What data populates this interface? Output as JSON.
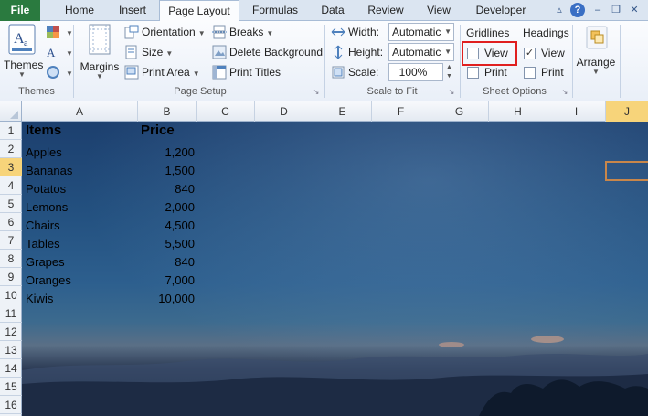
{
  "tabs": [
    "File",
    "Home",
    "Insert",
    "Page Layout",
    "Formulas",
    "Data",
    "Review",
    "View",
    "Developer"
  ],
  "active_tab": "Page Layout",
  "window_controls": {
    "help": "?",
    "minimize": "–",
    "restore": "❐",
    "close": "✕"
  },
  "ribbon": {
    "themes": {
      "themes_label": "Themes",
      "group_label": "Themes"
    },
    "page_setup": {
      "margins_label": "Margins",
      "orientation_label": "Orientation",
      "size_label": "Size",
      "print_area_label": "Print Area",
      "breaks_label": "Breaks",
      "delete_background_label": "Delete Background",
      "print_titles_label": "Print Titles",
      "group_label": "Page Setup"
    },
    "scale_to_fit": {
      "width_label": "Width:",
      "width_value": "Automatic",
      "height_label": "Height:",
      "height_value": "Automatic",
      "scale_label": "Scale:",
      "scale_value": "100%",
      "group_label": "Scale to Fit"
    },
    "sheet_options": {
      "gridlines_label": "Gridlines",
      "headings_label": "Headings",
      "gridlines_view_label": "View",
      "gridlines_view_checked": false,
      "gridlines_print_label": "Print",
      "gridlines_print_checked": false,
      "headings_view_label": "View",
      "headings_view_checked": true,
      "headings_print_label": "Print",
      "headings_print_checked": false,
      "group_label": "Sheet Options"
    },
    "arrange": {
      "arrange_label": "Arrange"
    }
  },
  "sheet": {
    "columns": [
      "A",
      "B",
      "C",
      "D",
      "E",
      "F",
      "G",
      "H",
      "I",
      "J"
    ],
    "rows": [
      "1",
      "2",
      "3",
      "4",
      "5",
      "6",
      "7",
      "8",
      "9",
      "10",
      "11",
      "12",
      "13",
      "14",
      "15",
      "16"
    ],
    "selected_row": "3",
    "selected_column": "J",
    "header": {
      "items": "Items",
      "price": "Price"
    },
    "data": [
      {
        "item": "Apples",
        "price": "1,200"
      },
      {
        "item": "Bananas",
        "price": "1,500"
      },
      {
        "item": "Potatos",
        "price": "840"
      },
      {
        "item": "Lemons",
        "price": "2,000"
      },
      {
        "item": "Chairs",
        "price": "4,500"
      },
      {
        "item": "Tables",
        "price": "5,500"
      },
      {
        "item": "Grapes",
        "price": "840"
      },
      {
        "item": "Oranges",
        "price": "7,000"
      },
      {
        "item": "Kiwis",
        "price": "10,000"
      }
    ]
  },
  "colors": {
    "file_tab": "#2a7a3f",
    "selection_header": "#f7d47a",
    "highlight_box": "#e01f1f",
    "selected_cell_border": "#c8864a"
  }
}
